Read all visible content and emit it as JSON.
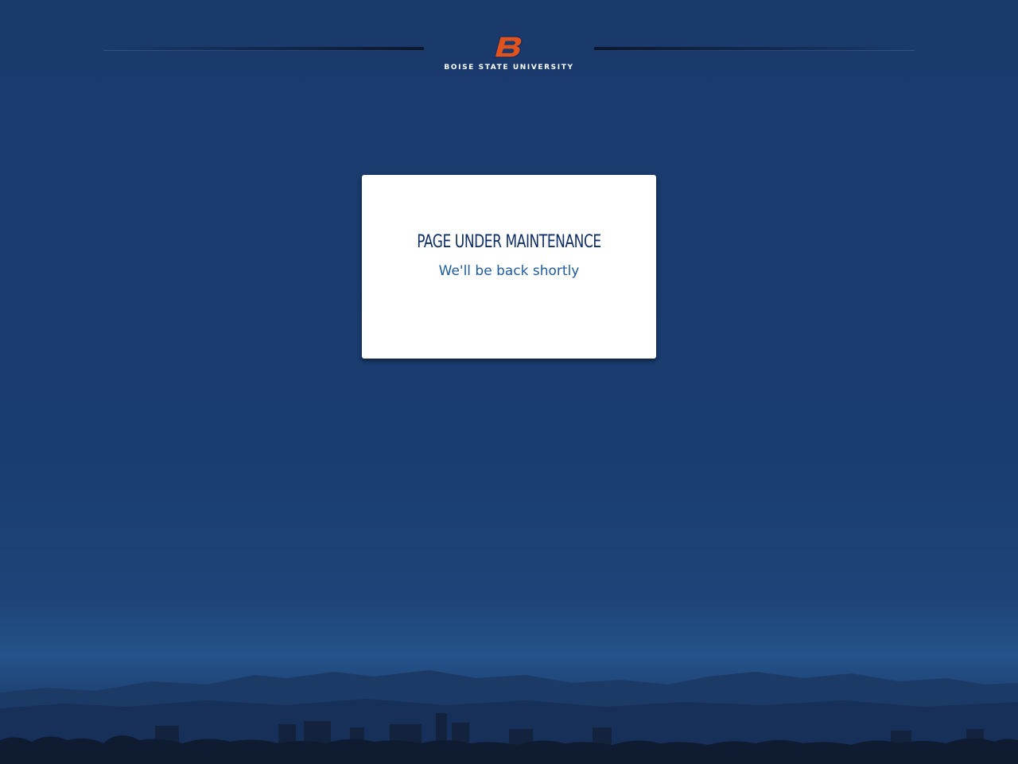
{
  "header": {
    "logo_icon": "boise-state-b-logo-icon",
    "wordmark": "BOISE STATE UNIVERSITY",
    "colors": {
      "brand_orange": "#e0531d",
      "brand_blue": "#0f2d66"
    }
  },
  "maintenance": {
    "title": "PAGE UNDER MAINTENANCE",
    "subtitle": "We'll be back shortly"
  },
  "background": {
    "colors": {
      "sky": "#1a3a6c",
      "horizon": "#24528a",
      "mountains": "#1c3a66",
      "city": "#0e1b30"
    }
  }
}
